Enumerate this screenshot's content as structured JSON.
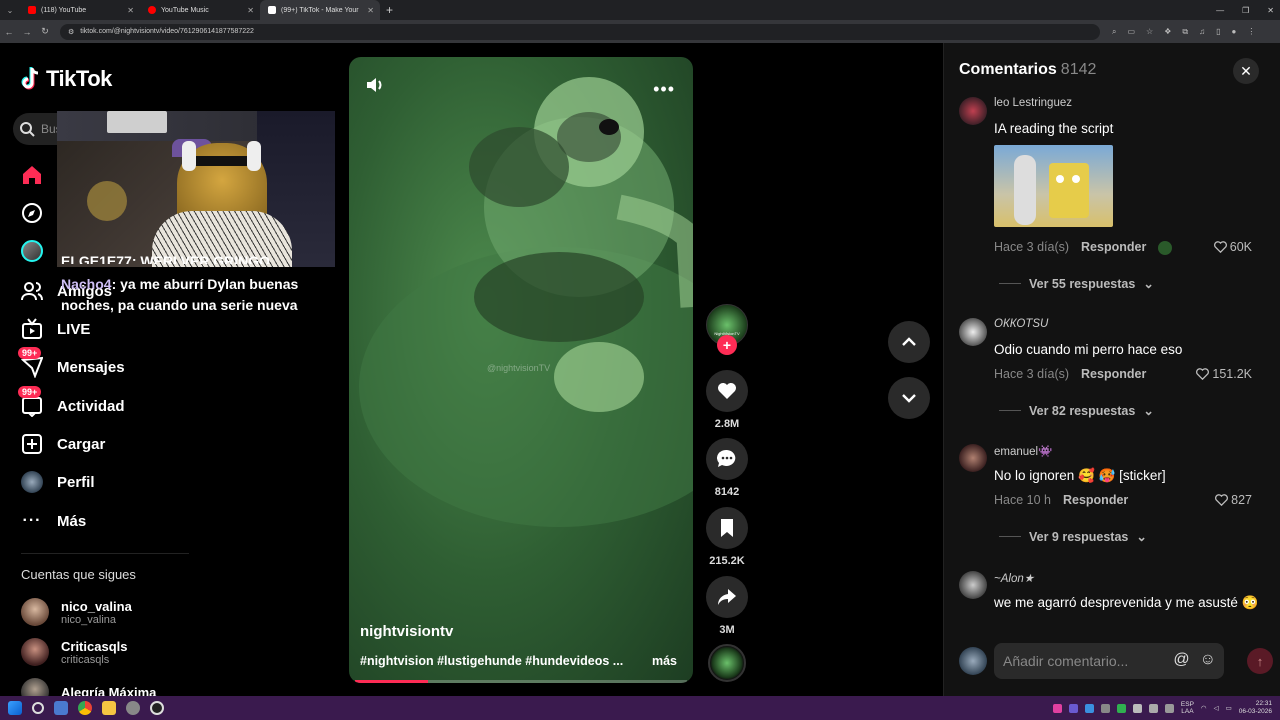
{
  "browser": {
    "tabs": [
      {
        "title": "(118) YouTube",
        "color": "#ff0000",
        "active": false
      },
      {
        "title": "YouTube Music",
        "color": "#ff0000",
        "active": false
      },
      {
        "title": "(99+) TikTok - Make Your Da",
        "color": "#ffffff",
        "active": true
      }
    ],
    "new_tab": "+",
    "url": "tiktok.com/@nightvisiontv/video/7612906141877587222"
  },
  "nav": {
    "logo": "TikTok",
    "search_placeholder": "Bus",
    "items": [
      {
        "label": "",
        "icon": "home-icon"
      },
      {
        "label": "",
        "icon": "explore-icon"
      },
      {
        "label": "",
        "icon": "following-avatar-icon"
      },
      {
        "label": "Amigos",
        "icon": "friends-icon"
      },
      {
        "label": "LIVE",
        "icon": "live-icon"
      },
      {
        "label": "Mensajes",
        "icon": "messages-icon",
        "badge": "99+"
      },
      {
        "label": "Actividad",
        "icon": "activity-icon",
        "badge": "99+"
      },
      {
        "label": "Cargar",
        "icon": "upload-icon"
      },
      {
        "label": "Perfil",
        "icon": "profile-avatar"
      },
      {
        "label": "Más",
        "icon": "more-icon"
      }
    ],
    "following_title": "Cuentas que sigues",
    "following": [
      {
        "name": "nico_valina",
        "handle": "nico_valina"
      },
      {
        "name": "Criticasqls",
        "handle": "criticasqls"
      },
      {
        "name": "Alegría Máxima",
        "handle": ""
      }
    ]
  },
  "stream": {
    "chat": [
      {
        "user": "",
        "text": "ELGE1E77: WERLVER GRINGO"
      },
      {
        "user": "Nacho4",
        "text": ": ya me aburrí Dylan buenas noches, pa cuando una serie nueva"
      }
    ]
  },
  "video": {
    "author": "nightvisiontv",
    "watermark": "@nightvisionTV",
    "description": "#nightvision #lustigehunde #hundevideos ...",
    "more": "más",
    "progress": 0.22,
    "avatar_label": "NightVisionTV"
  },
  "actions": {
    "likes": "2.8M",
    "comments": "8142",
    "saves": "215.2K",
    "shares": "3M"
  },
  "comments_panel": {
    "title": "Comentarios",
    "count": "8142",
    "comments": [
      {
        "user": "leo Lestringuez",
        "text": "IA reading the script",
        "time": "Hace 3 día(s)",
        "reply": "Responder",
        "likes": "60K",
        "thread": "Ver 55 respuestas",
        "has_gif": true
      },
      {
        "user": "ОККОТSU",
        "text": "Odio cuando mi perro hace eso",
        "time": "Hace 3 día(s)",
        "reply": "Responder",
        "likes": "151.2K",
        "thread": "Ver 82 respuestas"
      },
      {
        "user": "emanuel👾",
        "text": "No lo ignoren 🥰 🥵 [sticker]",
        "time": "Hace 10 h",
        "reply": "Responder",
        "likes": "827",
        "thread": "Ver 9 respuestas"
      },
      {
        "user": "~Alon★",
        "text": "we me agarró desprevenida y me asusté 😳",
        "time": "",
        "reply": "",
        "likes": "",
        "thread": ""
      }
    ],
    "input_placeholder": "Añadir comentario..."
  },
  "taskbar": {
    "lang": "ESP\nLAA",
    "time": "22:31",
    "date": "06-03-2026"
  }
}
